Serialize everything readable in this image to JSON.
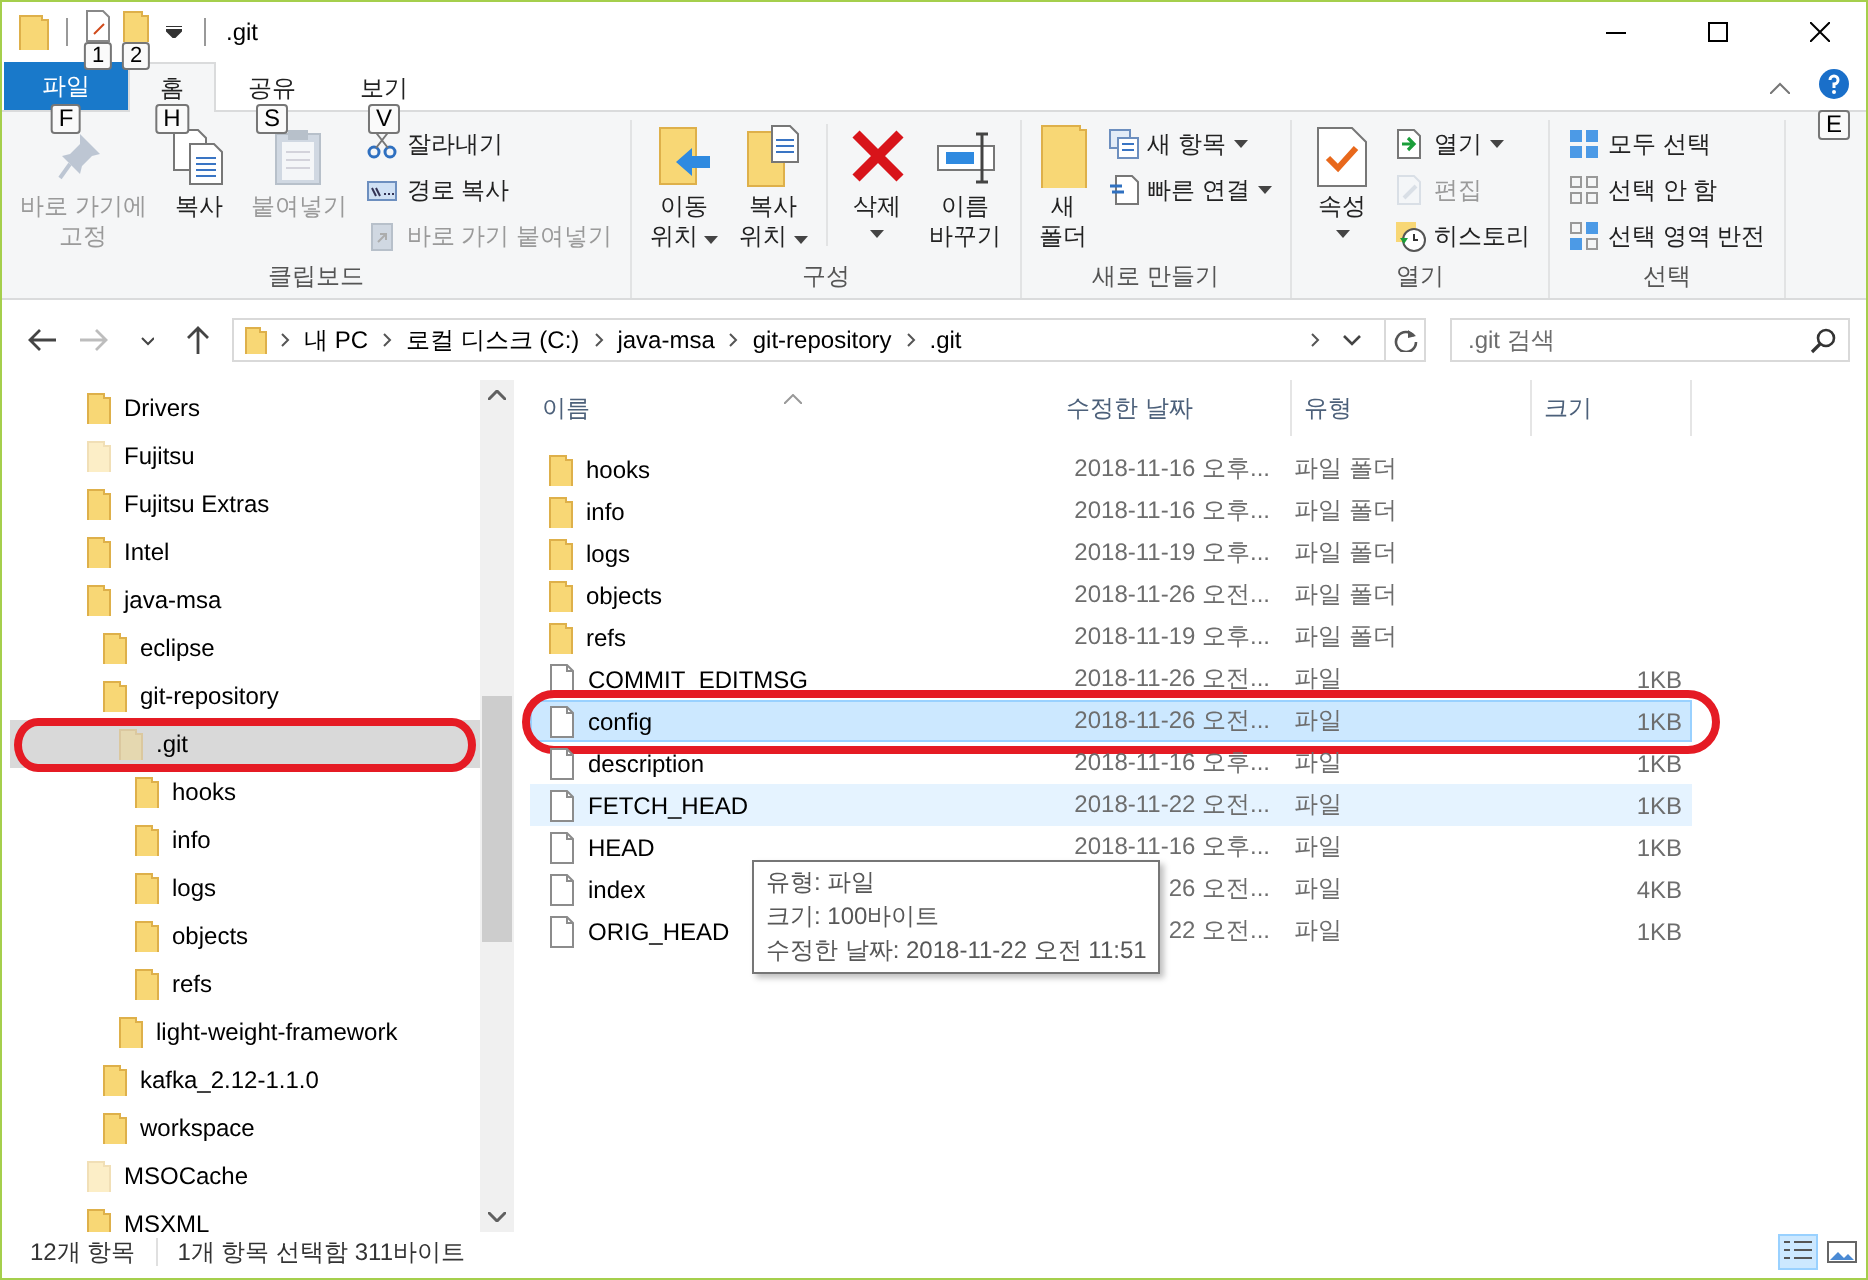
{
  "window": {
    "title": ".git"
  },
  "quick_access": [
    {
      "keytip": "1"
    },
    {
      "keytip": "2"
    }
  ],
  "tabs": [
    {
      "label": "파일",
      "keytip": "F",
      "kind": "file",
      "selected": false
    },
    {
      "label": "홈",
      "keytip": "H",
      "kind": "tab",
      "selected": true
    },
    {
      "label": "공유",
      "keytip": "S",
      "kind": "tab",
      "selected": false
    },
    {
      "label": "보기",
      "keytip": "V",
      "kind": "tab",
      "selected": false
    }
  ],
  "help_keytip": "E",
  "ribbon": {
    "groups": [
      {
        "label": "클립보드",
        "items": [
          {
            "kind": "large",
            "lines": [
              "바로 가기에",
              "고정"
            ],
            "disabled": true,
            "dropdown": false
          },
          {
            "kind": "large",
            "lines": [
              "복사"
            ],
            "disabled": false,
            "dropdown": false
          },
          {
            "kind": "large",
            "lines": [
              "붙여넣기"
            ],
            "disabled": true,
            "dropdown": false
          },
          {
            "kind": "small",
            "lines": [
              "잘라내기"
            ],
            "disabled": false,
            "dropdown": false
          },
          {
            "kind": "small",
            "lines": [
              "경로 복사"
            ],
            "disabled": false,
            "dropdown": false
          },
          {
            "kind": "small",
            "lines": [
              "바로 가기 붙여넣기"
            ],
            "disabled": true,
            "dropdown": false
          }
        ]
      },
      {
        "label": "구성",
        "items": [
          {
            "kind": "large",
            "lines": [
              "이동",
              "위치"
            ],
            "disabled": false,
            "dropdown": true
          },
          {
            "kind": "large",
            "lines": [
              "복사",
              "위치"
            ],
            "disabled": false,
            "dropdown": true
          },
          {
            "kind": "separator"
          },
          {
            "kind": "large",
            "lines": [
              "삭제"
            ],
            "disabled": false,
            "dropdown": true
          },
          {
            "kind": "large",
            "lines": [
              "이름",
              "바꾸기"
            ],
            "disabled": false,
            "dropdown": false
          }
        ]
      },
      {
        "label": "새로 만들기",
        "items": [
          {
            "kind": "large",
            "lines": [
              "새",
              "폴더"
            ],
            "disabled": false,
            "dropdown": false
          },
          {
            "kind": "small",
            "lines": [
              "새 항목"
            ],
            "disabled": false,
            "dropdown": true
          },
          {
            "kind": "small",
            "lines": [
              "빠른 연결"
            ],
            "disabled": false,
            "dropdown": true
          }
        ]
      },
      {
        "label": "열기",
        "items": [
          {
            "kind": "large",
            "lines": [
              "속성"
            ],
            "disabled": false,
            "dropdown": true
          },
          {
            "kind": "small",
            "lines": [
              "열기"
            ],
            "disabled": false,
            "dropdown": true
          },
          {
            "kind": "small",
            "lines": [
              "편집"
            ],
            "disabled": true,
            "dropdown": false
          },
          {
            "kind": "small",
            "lines": [
              "히스토리"
            ],
            "disabled": false,
            "dropdown": false
          }
        ]
      },
      {
        "label": "선택",
        "items": [
          {
            "kind": "small",
            "lines": [
              "모두 선택"
            ],
            "disabled": false,
            "dropdown": false
          },
          {
            "kind": "small",
            "lines": [
              "선택 안 함"
            ],
            "disabled": false,
            "dropdown": false
          },
          {
            "kind": "small",
            "lines": [
              "선택 영역 반전"
            ],
            "disabled": false,
            "dropdown": false
          }
        ]
      }
    ]
  },
  "nav_buttons": [
    {
      "kind": "back",
      "disabled": false
    },
    {
      "kind": "forward",
      "disabled": true
    },
    {
      "kind": "recent",
      "disabled": false
    },
    {
      "kind": "up",
      "disabled": false
    }
  ],
  "address": {
    "crumbs": [
      "내 PC",
      "로컬 디스크 (C:)",
      "java-msa",
      "git-repository",
      ".git"
    ],
    "search_placeholder": ".git 검색"
  },
  "tree": {
    "items": [
      {
        "label": "Drivers",
        "hidden": false,
        "selected": false,
        "annotated": false
      },
      {
        "label": "Fujitsu",
        "hidden": true,
        "selected": false,
        "annotated": false
      },
      {
        "label": "Fujitsu Extras",
        "hidden": false,
        "selected": false,
        "annotated": false
      },
      {
        "label": "Intel",
        "hidden": false,
        "selected": false,
        "annotated": false
      },
      {
        "label": "java-msa",
        "hidden": false,
        "selected": false,
        "annotated": false,
        "children": [
          {
            "label": "eclipse",
            "hidden": false,
            "selected": false,
            "annotated": false
          },
          {
            "label": "git-repository",
            "hidden": false,
            "selected": false,
            "annotated": false,
            "children": [
              {
                "label": ".git",
                "hidden": true,
                "selected": true,
                "annotated": true,
                "children": [
                  {
                    "label": "hooks",
                    "hidden": false,
                    "selected": false,
                    "annotated": false
                  },
                  {
                    "label": "info",
                    "hidden": false,
                    "selected": false,
                    "annotated": false
                  },
                  {
                    "label": "logs",
                    "hidden": false,
                    "selected": false,
                    "annotated": false
                  },
                  {
                    "label": "objects",
                    "hidden": false,
                    "selected": false,
                    "annotated": false
                  },
                  {
                    "label": "refs",
                    "hidden": false,
                    "selected": false,
                    "annotated": false
                  }
                ]
              },
              {
                "label": "light-weight-framework",
                "hidden": false,
                "selected": false,
                "annotated": false
              }
            ]
          },
          {
            "label": "kafka_2.12-1.1.0",
            "hidden": false,
            "selected": false,
            "annotated": false
          },
          {
            "label": "workspace",
            "hidden": false,
            "selected": false,
            "annotated": false
          }
        ]
      },
      {
        "label": "MSOCache",
        "hidden": true,
        "selected": false,
        "annotated": false
      },
      {
        "label": "MSXML",
        "hidden": false,
        "selected": false,
        "annotated": false
      }
    ]
  },
  "file_list": {
    "columns": [
      {
        "label": "이름",
        "sorted": true
      },
      {
        "label": "수정한 날짜",
        "sorted": false
      },
      {
        "label": "유형",
        "sorted": false
      },
      {
        "label": "크기",
        "sorted": false
      }
    ],
    "rows": [
      {
        "kind": "folder",
        "name": "hooks",
        "date": "2018-11-16 오후...",
        "type": "파일 폴더",
        "size": "",
        "selected": false,
        "hovered": false,
        "annotated": false
      },
      {
        "kind": "folder",
        "name": "info",
        "date": "2018-11-16 오후...",
        "type": "파일 폴더",
        "selected": false,
        "hovered": false,
        "annotated": false
      },
      {
        "kind": "folder",
        "name": "logs",
        "date": "2018-11-19 오후...",
        "type": "파일 폴더",
        "selected": false,
        "hovered": false,
        "annotated": false
      },
      {
        "kind": "folder",
        "name": "objects",
        "date": "2018-11-26 오전...",
        "type": "파일 폴더",
        "selected": false,
        "hovered": false,
        "annotated": false
      },
      {
        "kind": "folder",
        "name": "refs",
        "date": "2018-11-19 오후...",
        "type": "파일 폴더",
        "selected": false,
        "hovered": false,
        "annotated": false
      },
      {
        "kind": "file",
        "name": "COMMIT_EDITMSG",
        "date": "2018-11-26 오전...",
        "type": "파일",
        "size": "1KB",
        "selected": false,
        "hovered": false,
        "annotated": false
      },
      {
        "kind": "file",
        "name": "config",
        "date": "2018-11-26 오전...",
        "type": "파일",
        "size": "1KB",
        "selected": true,
        "hovered": false,
        "annotated": true
      },
      {
        "kind": "file",
        "name": "description",
        "date": "2018-11-16 오후...",
        "type": "파일",
        "size": "1KB",
        "selected": false,
        "hovered": false,
        "annotated": false
      },
      {
        "kind": "file",
        "name": "FETCH_HEAD",
        "date": "2018-11-22 오전...",
        "type": "파일",
        "size": "1KB",
        "selected": false,
        "hovered": true,
        "annotated": false
      },
      {
        "kind": "file",
        "name": "HEAD",
        "date": "2018-11-16 오후...",
        "type": "파일",
        "size": "1KB",
        "selected": false,
        "hovered": false,
        "annotated": false
      },
      {
        "kind": "file",
        "name": "index",
        "date": "26 오전...",
        "type": "파일",
        "size": "4KB",
        "selected": false,
        "hovered": false,
        "annotated": false
      },
      {
        "kind": "file",
        "name": "ORIG_HEAD",
        "date": "22 오전...",
        "type": "파일",
        "size": "1KB",
        "selected": false,
        "hovered": false,
        "annotated": false
      }
    ]
  },
  "tooltip": {
    "lines": [
      "유형: 파일",
      "크기: 100바이트",
      "수정한 날짜: 2018-11-22 오전 11:51"
    ]
  },
  "status_bar": {
    "count": "12개 항목",
    "selection": "1개 항목 선택함 311바이트",
    "views": [
      {
        "kind": "details",
        "selected": true
      },
      {
        "kind": "large_icons",
        "selected": false
      }
    ]
  }
}
